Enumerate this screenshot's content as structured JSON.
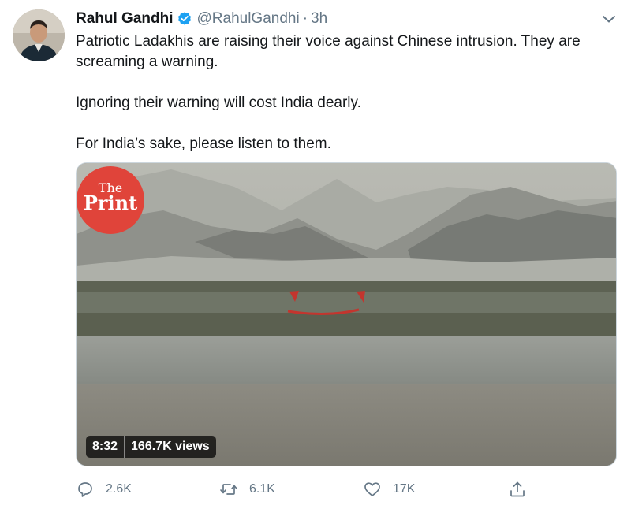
{
  "author": {
    "name": "Rahul Gandhi",
    "handle": "@RahulGandhi",
    "separator": "·",
    "time": "3h",
    "verified": true
  },
  "tweet": {
    "line1": "Patriotic Ladakhis are raising their voice against Chinese intrusion. They are screaming a warning.",
    "line2": "Ignoring their warning will cost India dearly.",
    "line3": "For India’s sake, please listen to them."
  },
  "media": {
    "logo_top": "The",
    "logo_bottom": "Print",
    "duration": "8:32",
    "views": "166.7K views"
  },
  "actions": {
    "reply_count": "2.6K",
    "retweet_count": "6.1K",
    "like_count": "17K"
  },
  "colors": {
    "verified_blue": "#1da1f2",
    "secondary_text": "#657786",
    "logo_red": "#e0443a"
  },
  "icons": [
    "avatar",
    "verified-badge-icon",
    "chevron-down-icon",
    "reply-icon",
    "retweet-icon",
    "like-icon",
    "share-icon"
  ]
}
